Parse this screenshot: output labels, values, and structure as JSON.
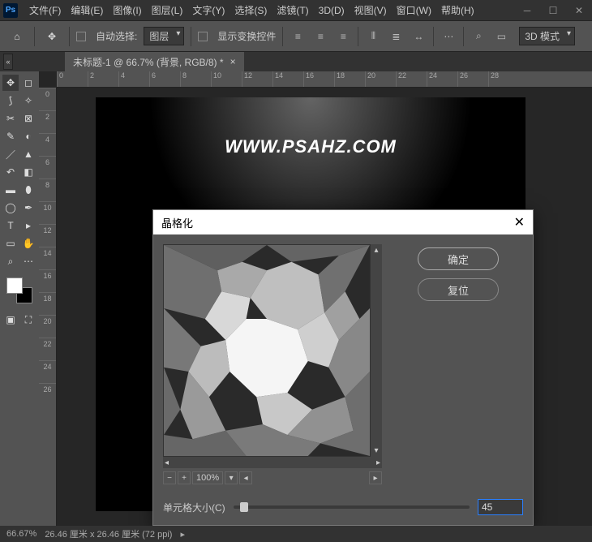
{
  "menu": {
    "file": "文件(F)",
    "edit": "编辑(E)",
    "image": "图像(I)",
    "layer": "图层(L)",
    "type": "文字(Y)",
    "select": "选择(S)",
    "filter": "滤镜(T)",
    "threeD": "3D(D)",
    "view": "视图(V)",
    "window": "窗口(W)",
    "help": "帮助(H)"
  },
  "options": {
    "autoSelect": "自动选择:",
    "dropdown": "图层",
    "showTransform": "显示变换控件",
    "threeDMode": "3D 模式"
  },
  "tab": {
    "label": "未标题-1 @ 66.7% (背景, RGB/8) *"
  },
  "rulerH": [
    "0",
    "2",
    "4",
    "6",
    "8",
    "10",
    "12",
    "14",
    "16",
    "18",
    "20",
    "22",
    "24",
    "26",
    "28"
  ],
  "rulerV": [
    "0",
    "2",
    "4",
    "6",
    "8",
    "10",
    "12",
    "14",
    "16",
    "18",
    "20",
    "22",
    "24",
    "26"
  ],
  "watermark": "WWW.PSAHZ.COM",
  "dialog": {
    "title": "晶格化",
    "ok": "确定",
    "reset": "复位",
    "zoom": "100%",
    "paramLabel": "单元格大小(C)",
    "paramValue": "45"
  },
  "status": {
    "zoom": "66.67%",
    "dim": "26.46 厘米 x 26.46 厘米 (72 ppi)"
  }
}
